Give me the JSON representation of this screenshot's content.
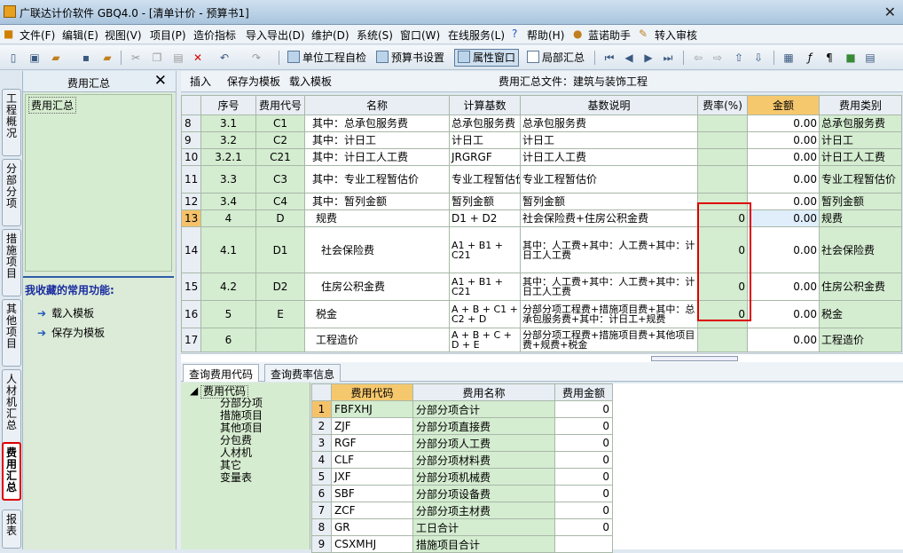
{
  "window": {
    "title": "广联达计价软件 GBQ4.0 - [清单计价 - 预算书1]",
    "close": "✕"
  },
  "menu": [
    "文件(F)",
    "编辑(E)",
    "视图(V)",
    "项目(P)",
    "造价指标",
    "导入导出(D)",
    "维护(D)",
    "系统(S)",
    "窗口(W)",
    "在线服务(L)",
    "帮助(H)",
    "蓝诺助手",
    "转入审核"
  ],
  "toolbar": {
    "unit_check": "单位工程自检",
    "budget_settings": "预算书设置",
    "property_window": "属性窗口",
    "local_summary": "局部汇总"
  },
  "vtabs": [
    "工程概况",
    "分部分项",
    "措施项目",
    "其他项目",
    "人材机汇总",
    "费用汇总",
    "报表"
  ],
  "left_panel": {
    "title": "费用汇总",
    "tree_item": "费用汇总",
    "favorites_title": "我收藏的常用功能:",
    "favorites": [
      "载入模板",
      "保存为模板"
    ]
  },
  "main_toolbar": {
    "insert": "插入",
    "save_template": "保存为模板",
    "load_template": "载入模板",
    "file_label": "费用汇总文件：建筑与装饰工程"
  },
  "grid": {
    "headers": [
      "",
      "序号",
      "费用代号",
      "名称",
      "计算基数",
      "基数说明",
      "费率(%)",
      "金额",
      "费用类别"
    ],
    "rows": [
      {
        "rn": "8",
        "seq": "3.1",
        "code": "C1",
        "name": "其中：总承包服务费",
        "base": "总承包服务费",
        "desc": "总承包服务费",
        "rate": "",
        "amount": "0.00",
        "cat": "总承包服务费"
      },
      {
        "rn": "9",
        "seq": "3.2",
        "code": "C2",
        "name": "其中：计日工",
        "base": "计日工",
        "desc": "计日工",
        "rate": "",
        "amount": "0.00",
        "cat": "计日工"
      },
      {
        "rn": "10",
        "seq": "3.2.1",
        "code": "C21",
        "name": "其中：计日工人工费",
        "base": "JRGRGF",
        "desc": "计日工人工费",
        "rate": "",
        "amount": "0.00",
        "cat": "计日工人工费"
      },
      {
        "rn": "11",
        "seq": "3.3",
        "code": "C3",
        "name": "其中：专业工程暂估价",
        "base": "专业工程暂估价",
        "desc": "专业工程暂估价",
        "rate": "",
        "amount": "0.00",
        "cat": "专业工程暂估价"
      },
      {
        "rn": "12",
        "seq": "3.4",
        "code": "C4",
        "name": "其中：暂列金额",
        "base": "暂列金额",
        "desc": "暂列金额",
        "rate": "",
        "amount": "0.00",
        "cat": "暂列金额"
      },
      {
        "rn": "13",
        "seq": "4",
        "code": "D",
        "name": "规费",
        "base": "D1 + D2",
        "desc": "社会保险费+住房公积金费",
        "rate": "0",
        "amount": "0.00",
        "cat": "规费"
      },
      {
        "rn": "14",
        "seq": "4.1",
        "code": "D1",
        "name": "社会保险费",
        "base": "A1 + B1 + C21",
        "desc": "其中：人工费+其中：人工费+其中：计日工人工费",
        "rate": "0",
        "amount": "0.00",
        "cat": "社会保险费"
      },
      {
        "rn": "15",
        "seq": "4.2",
        "code": "D2",
        "name": "住房公积金费",
        "base": "A1 + B1 + C21",
        "desc": "其中：人工费+其中：人工费+其中：计日工人工费",
        "rate": "0",
        "amount": "0.00",
        "cat": "住房公积金费"
      },
      {
        "rn": "16",
        "seq": "5",
        "code": "E",
        "name": "税金",
        "base": "A + B + C1 + C2 + D",
        "desc": "分部分项工程费+措施项目费+其中：总承包服务费+其中：计日工+规费",
        "rate": "0",
        "amount": "0.00",
        "cat": "税金"
      },
      {
        "rn": "17",
        "seq": "6",
        "code": "",
        "name": "工程造价",
        "base": "A + B + C + D + E",
        "desc": "分部分项工程费+措施项目费+其他项目费+规费+税金",
        "rate": "",
        "amount": "0.00",
        "cat": "工程造价"
      }
    ]
  },
  "bottom_tabs": [
    "查询费用代码",
    "查询费率信息"
  ],
  "code_tree": {
    "root": "费用代码",
    "children": [
      "分部分项",
      "措施项目",
      "其他项目",
      "分包费",
      "人材机",
      "其它",
      "变量表"
    ]
  },
  "code_grid": {
    "headers": [
      "",
      "费用代码",
      "费用名称",
      "费用金额"
    ],
    "rows": [
      {
        "rn": "1",
        "code": "FBFXHJ",
        "name": "分部分项合计",
        "amount": "0"
      },
      {
        "rn": "2",
        "code": "ZJF",
        "name": "分部分项直接费",
        "amount": "0"
      },
      {
        "rn": "3",
        "code": "RGF",
        "name": "分部分项人工费",
        "amount": "0"
      },
      {
        "rn": "4",
        "code": "CLF",
        "name": "分部分项材料费",
        "amount": "0"
      },
      {
        "rn": "5",
        "code": "JXF",
        "name": "分部分项机械费",
        "amount": "0"
      },
      {
        "rn": "6",
        "code": "SBF",
        "name": "分部分项设备费",
        "amount": "0"
      },
      {
        "rn": "7",
        "code": "ZCF",
        "name": "分部分项主材费",
        "amount": "0"
      },
      {
        "rn": "8",
        "code": "GR",
        "name": "工日合计",
        "amount": "0"
      },
      {
        "rn": "9",
        "code": "CSXMHJ",
        "name": "措施项目合计",
        "amount": ""
      }
    ]
  }
}
